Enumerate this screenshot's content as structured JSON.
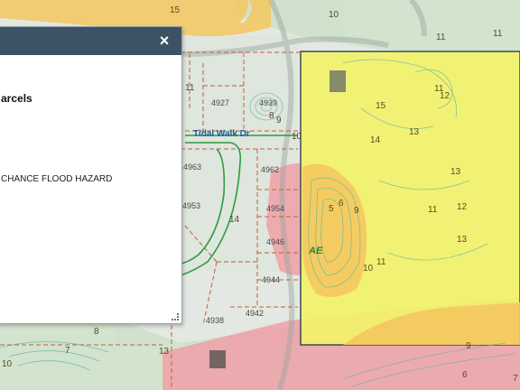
{
  "popup": {
    "close_label": "×",
    "title": "arcels",
    "flood_zone_text": "CHANCE FLOOD HAZARD"
  },
  "map": {
    "street_label": "Tidal Walk Dr",
    "flood_zone_label": "AE",
    "lot_numbers": [
      "4927",
      "4939",
      "4963",
      "4962",
      "4953",
      "4954",
      "4946",
      "4944",
      "4938",
      "4942"
    ],
    "contour_labels": [
      "15",
      "10",
      "11",
      "11",
      "11",
      "12",
      "15",
      "14",
      "13",
      "13",
      "11",
      "12",
      "13",
      "8",
      "9",
      "10",
      "14",
      "5",
      "6",
      "9",
      "10",
      "11",
      "7",
      "8",
      "13",
      "9",
      "6",
      "7",
      "10",
      "11"
    ],
    "colors": {
      "flood_zone_yellow": "#f2f26a",
      "flood_zone_orange": "#f5c860",
      "flood_zone_pink": "#f0a0a8",
      "parcel_line": "#c0603a",
      "street_line": "#2f9a44",
      "contour_line": "#5fb5a5",
      "popup_header": "#3b5365"
    }
  }
}
